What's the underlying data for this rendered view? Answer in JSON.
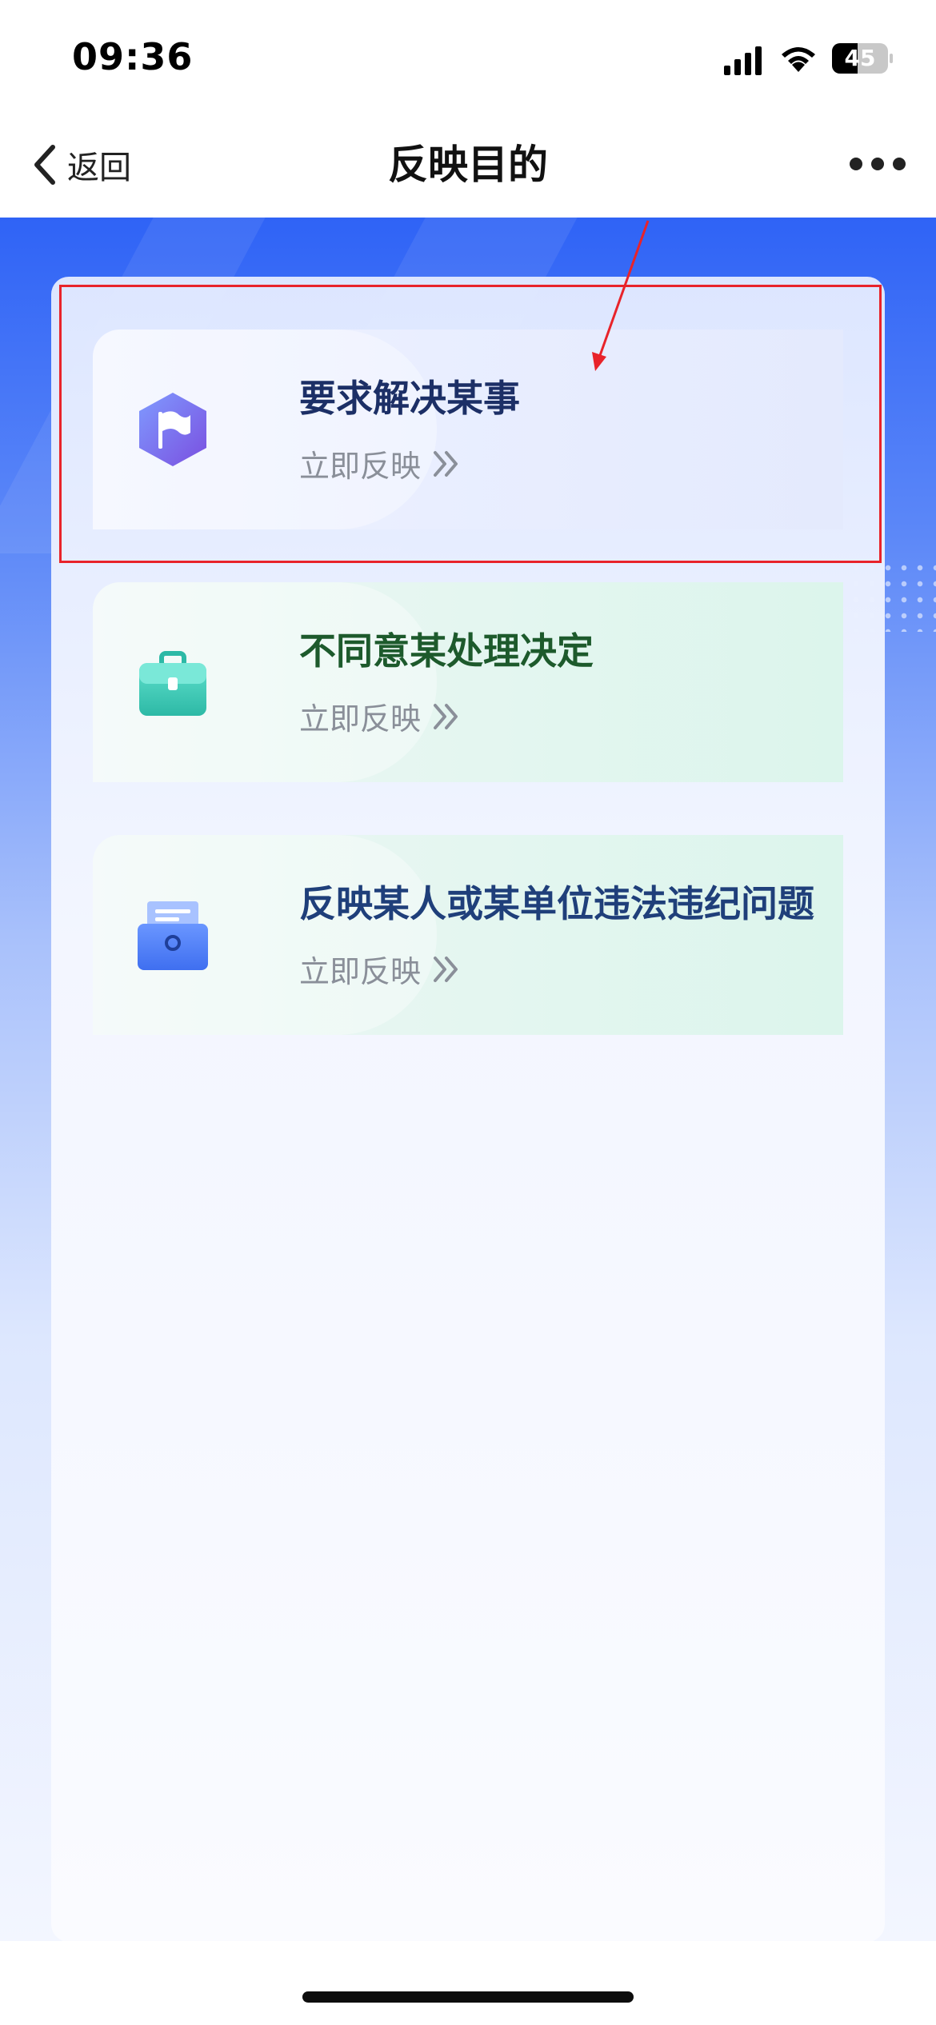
{
  "status_bar": {
    "time": "09:36",
    "battery_level": "45",
    "battery_fraction": 0.45,
    "icons": [
      "signal-icon",
      "wifi-icon",
      "battery-icon"
    ]
  },
  "nav": {
    "back_label": "返回",
    "title": "反映目的",
    "icons": [
      "chevron-left-icon",
      "more-icon"
    ]
  },
  "cards": [
    {
      "title": "要求解决某事",
      "link_label": "立即反映",
      "icon": "flag-hexagon-icon"
    },
    {
      "title": "不同意某处理决定",
      "link_label": "立即反映",
      "icon": "briefcase-icon"
    },
    {
      "title": "反映某人或某单位违法违纪问题",
      "link_label": "立即反映",
      "icon": "inbox-report-icon"
    }
  ],
  "colors": {
    "accent_blue": "#2f63f6",
    "annotation_red": "#e8232a",
    "card_title_blue": "#1c2f66",
    "card_title_green": "#1d5a2c",
    "card_title_navy": "#1f3f7a",
    "link_gray": "#8a8f99"
  }
}
